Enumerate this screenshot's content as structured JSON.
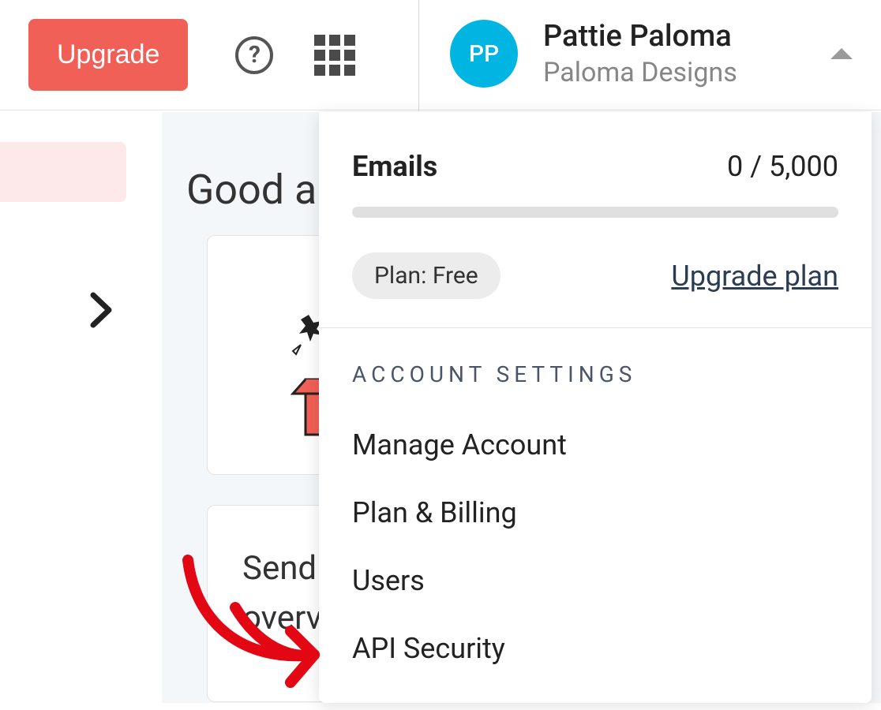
{
  "topbar": {
    "upgrade_label": "Upgrade",
    "help_glyph": "?"
  },
  "account": {
    "initials": "PP",
    "name": "Pattie Paloma",
    "org": "Paloma Designs"
  },
  "greeting": "Good a",
  "card2": {
    "line1": "Sendi",
    "line2": "overvi"
  },
  "dropdown": {
    "emails_label": "Emails",
    "emails_count": "0 / 5,000",
    "plan_badge": "Plan: Free",
    "upgrade_link": "Upgrade plan",
    "settings_heading": "ACCOUNT SETTINGS",
    "items": [
      "Manage Account",
      "Plan & Billing",
      "Users",
      "API Security"
    ]
  }
}
